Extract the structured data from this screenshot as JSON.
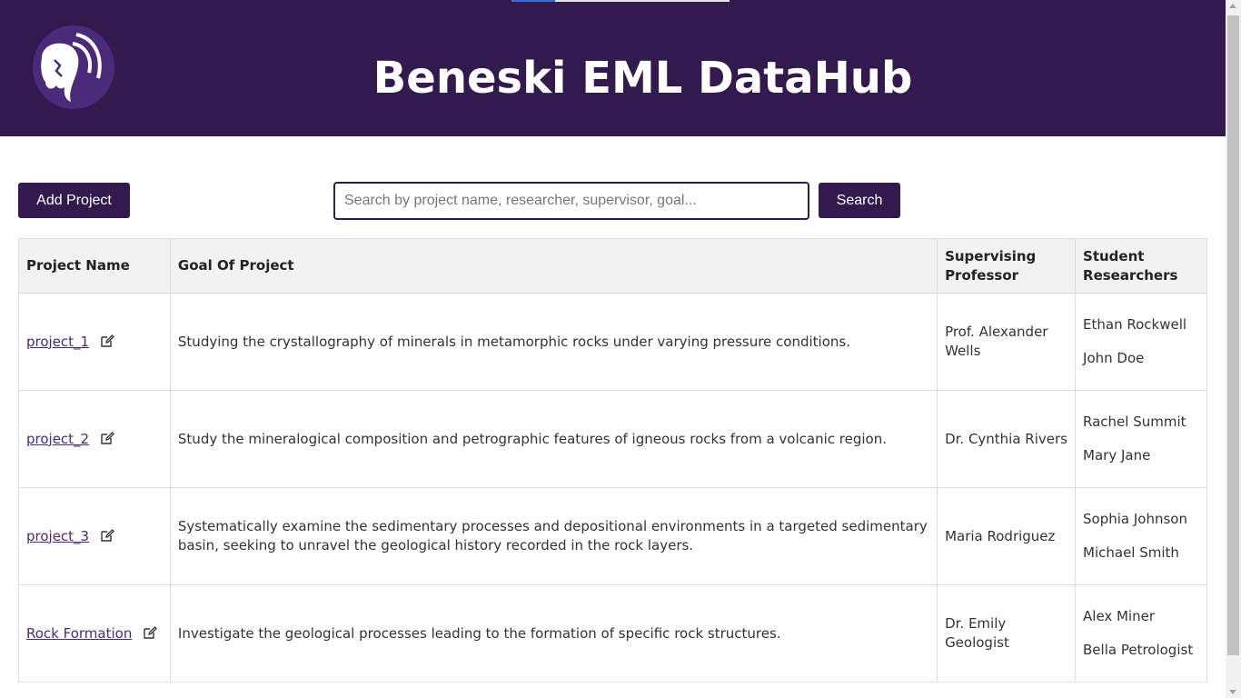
{
  "app": {
    "title": "Beneski EML DataHub"
  },
  "loading": {
    "progress": 0.2
  },
  "toolbar": {
    "add_label": "Add Project",
    "search_placeholder": "Search by project name, researcher, supervisor, goal...",
    "search_value": "",
    "search_label": "Search"
  },
  "table": {
    "headers": {
      "name": "Project Name",
      "goal": "Goal Of Project",
      "professor": "Supervising Professor",
      "students": "Student Researchers"
    },
    "rows": [
      {
        "name": "project_1",
        "goal": "Studying the crystallography of minerals in metamorphic rocks under varying pressure conditions.",
        "professor": "Prof. Alexander Wells",
        "students": [
          "Ethan Rockwell",
          "John Doe"
        ]
      },
      {
        "name": "project_2",
        "goal": "Study the mineralogical composition and petrographic features of igneous rocks from a volcanic region.",
        "professor": "Dr. Cynthia Rivers",
        "students": [
          "Rachel Summit",
          "Mary Jane"
        ]
      },
      {
        "name": "project_3",
        "goal": "Systematically examine the sedimentary processes and depositional environments in a targeted sedimentary basin, seeking to unravel the geological history recorded in the rock layers.",
        "professor": "Maria Rodriguez",
        "students": [
          "Sophia Johnson",
          "Michael Smith"
        ]
      },
      {
        "name": "Rock Formation",
        "goal": "Investigate the geological processes leading to the formation of specific rock structures.",
        "professor": "Dr. Emily Geologist",
        "students": [
          "Alex Miner",
          "Bella Petrologist"
        ]
      }
    ]
  },
  "colors": {
    "brand": "#321a4f",
    "link": "#4b2a7c",
    "header_bg": "#f2f2f2"
  },
  "icons": {
    "logo": "elephant-logo-icon",
    "edit": "edit-icon"
  }
}
